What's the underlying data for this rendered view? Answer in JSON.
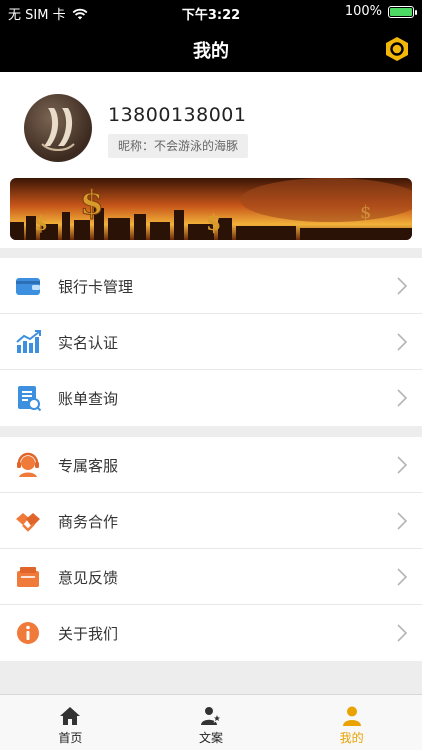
{
  "status_bar": {
    "carrier": "无 SIM 卡",
    "time": "下午3:22",
    "battery": "100%",
    "battery_level": 1.0
  },
  "navbar": {
    "title": "我的",
    "settings_icon": "hexagon-gear-icon"
  },
  "profile": {
    "phone": "13800138001",
    "nickname": "昵称：不会游泳的海豚"
  },
  "menu_group_1": [
    {
      "label": "银行卡管理",
      "icon": "wallet-icon"
    },
    {
      "label": "实名认证",
      "icon": "chart-icon"
    },
    {
      "label": "账单查询",
      "icon": "bill-search-icon"
    }
  ],
  "menu_group_2": [
    {
      "label": "专属客服",
      "icon": "customer-service-icon"
    },
    {
      "label": "商务合作",
      "icon": "handshake-icon"
    },
    {
      "label": "意见反馈",
      "icon": "feedback-icon"
    },
    {
      "label": "关于我们",
      "icon": "info-icon"
    }
  ],
  "tab_bar": {
    "tabs": [
      {
        "label": "首页",
        "icon": "home-icon"
      },
      {
        "label": "文案",
        "icon": "user-star-icon"
      },
      {
        "label": "我的",
        "icon": "person-icon",
        "active": true
      }
    ]
  },
  "colors": {
    "accent": "#e9a200",
    "navbar": "#000000"
  }
}
